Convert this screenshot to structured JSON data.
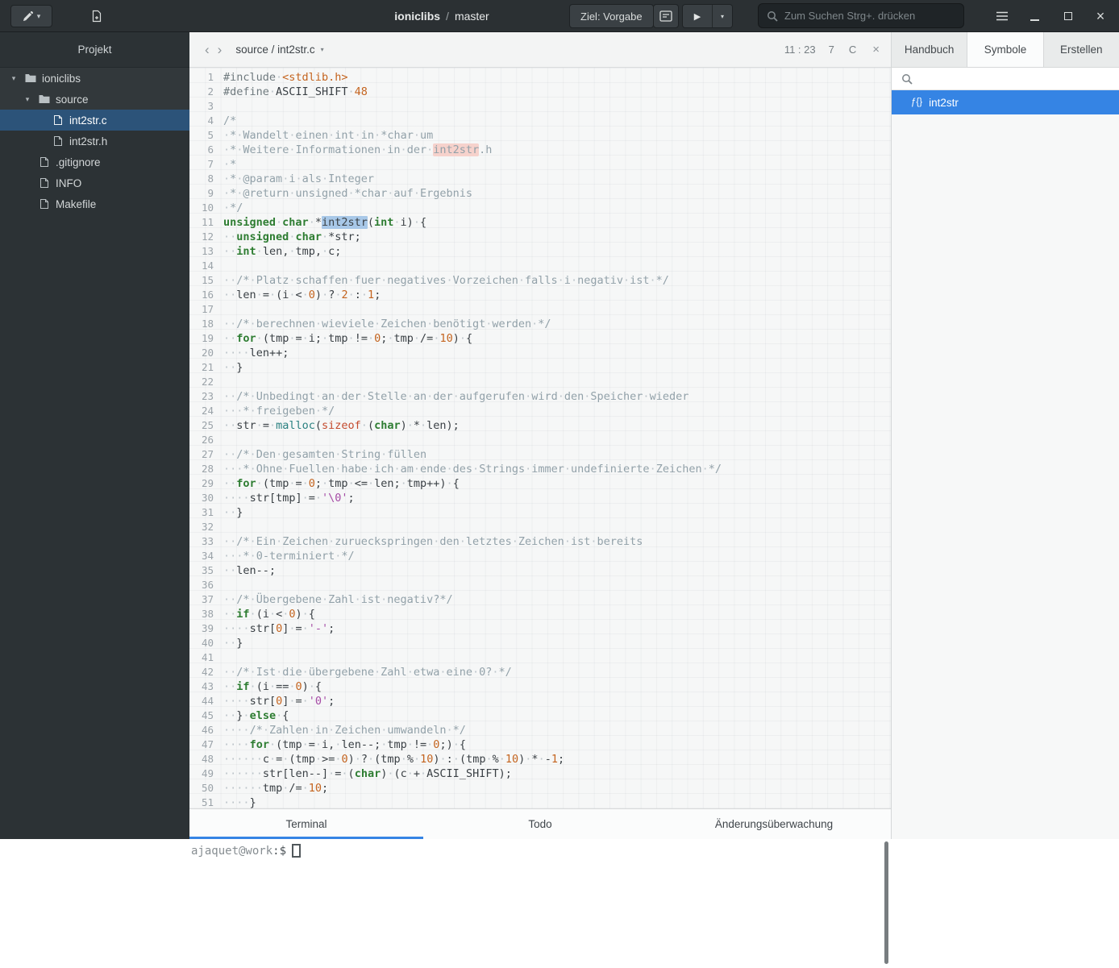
{
  "header": {
    "project": "ioniclibs",
    "separator": "/",
    "branch": "master",
    "target_button": "Ziel: Vorgabe",
    "search_placeholder": "Zum Suchen Strg+. drücken"
  },
  "sidebar": {
    "title": "Projekt",
    "tree": [
      {
        "label": "ioniclibs",
        "type": "folder",
        "depth": 0,
        "expanded": true,
        "selected": false
      },
      {
        "label": "source",
        "type": "folder",
        "depth": 1,
        "expanded": true,
        "selected": false
      },
      {
        "label": "int2str.c",
        "type": "file",
        "depth": 2,
        "expanded": false,
        "selected": true
      },
      {
        "label": "int2str.h",
        "type": "file",
        "depth": 2,
        "expanded": false,
        "selected": false
      },
      {
        "label": ".gitignore",
        "type": "file",
        "depth": 1,
        "expanded": false,
        "selected": false
      },
      {
        "label": "INFO",
        "type": "file",
        "depth": 1,
        "expanded": false,
        "selected": false
      },
      {
        "label": "Makefile",
        "type": "file",
        "depth": 1,
        "expanded": false,
        "selected": false
      }
    ]
  },
  "editor": {
    "breadcrumb": "source / int2str.c",
    "position": "11 : 23",
    "diagnostics": "7",
    "language": "C",
    "lines": [
      "#include <stdlib.h>",
      "#define ASCII_SHIFT 48",
      "",
      "/*",
      " * Wandelt einen int in *char um",
      " * Weitere Informationen in der int2str.h",
      " *",
      " * @param i als Integer",
      " * @return unsigned *char auf Ergebnis",
      " */",
      "unsigned char *int2str(int i) {",
      "  unsigned char *str;",
      "  int len, tmp, c;",
      "",
      "  /* Platz schaffen fuer negatives Vorzeichen falls i negativ ist */",
      "  len = (i < 0) ? 2 : 1;",
      "",
      "  /* berechnen wieviele Zeichen benötigt werden */",
      "  for (tmp = i; tmp != 0; tmp /= 10) {",
      "    len++;",
      "  }",
      "",
      "  /* Unbedingt an der Stelle an der aufgerufen wird den Speicher wieder",
      "   * freigeben */",
      "  str = malloc(sizeof (char) * len);",
      "",
      "  /* Den gesamten String füllen",
      "   * Ohne Fuellen habe ich am ende des Strings immer undefinierte Zeichen */",
      "  for (tmp = 0; tmp <= len; tmp++) {",
      "    str[tmp] = '\\0';",
      "  }",
      "",
      "  /* Ein Zeichen zurueckspringen den letztes Zeichen ist bereits",
      "   * 0-terminiert */",
      "  len--;",
      "",
      "  /* Übergebene Zahl ist negativ?*/",
      "  if (i < 0) {",
      "    str[0] = '-';",
      "  }",
      "",
      "  /* Ist die übergebene Zahl etwa eine 0? */",
      "  if (i == 0) {",
      "    str[0] = '0';",
      "  } else {",
      "    /* Zahlen in Zeichen umwandeln */",
      "    for (tmp = i, len--; tmp != 0;) {",
      "      c = (tmp >= 0) ? (tmp % 10) : (tmp % 10) * -1;",
      "      str[len--] = (char) (c + ASCII_SHIFT);",
      "      tmp /= 10;",
      "    }"
    ],
    "highlights": [
      {
        "line": 6,
        "text": "int2str",
        "cls": "occ"
      },
      {
        "line": 11,
        "text": "int2str",
        "cls": "sel"
      }
    ]
  },
  "right_panel": {
    "tabs": [
      "Handbuch",
      "Symbole",
      "Erstellen"
    ],
    "active_tab": "Symbole",
    "symbols": [
      {
        "icon": "ƒ{}",
        "label": "int2str",
        "selected": true
      }
    ]
  },
  "bottom_panel": {
    "tabs": [
      "Terminal",
      "Todo",
      "Änderungsüberwachung"
    ],
    "active_tab": "Terminal",
    "terminal_user": "ajaquet@work",
    "terminal_suffix": ":$"
  },
  "icons": {
    "caret_down": "▾",
    "expander_open": "▾",
    "chevron_left": "‹",
    "chevron_right": "›",
    "close": "×",
    "play": "▶",
    "function_badge": "ƒ{}"
  },
  "colors": {
    "accent": "#3584e4",
    "selection_highlight": "#a8c8e8",
    "occurrence_highlight": "#f6d2cc",
    "header_background": "#2b3033",
    "sidebar_background": "#2c3235"
  }
}
